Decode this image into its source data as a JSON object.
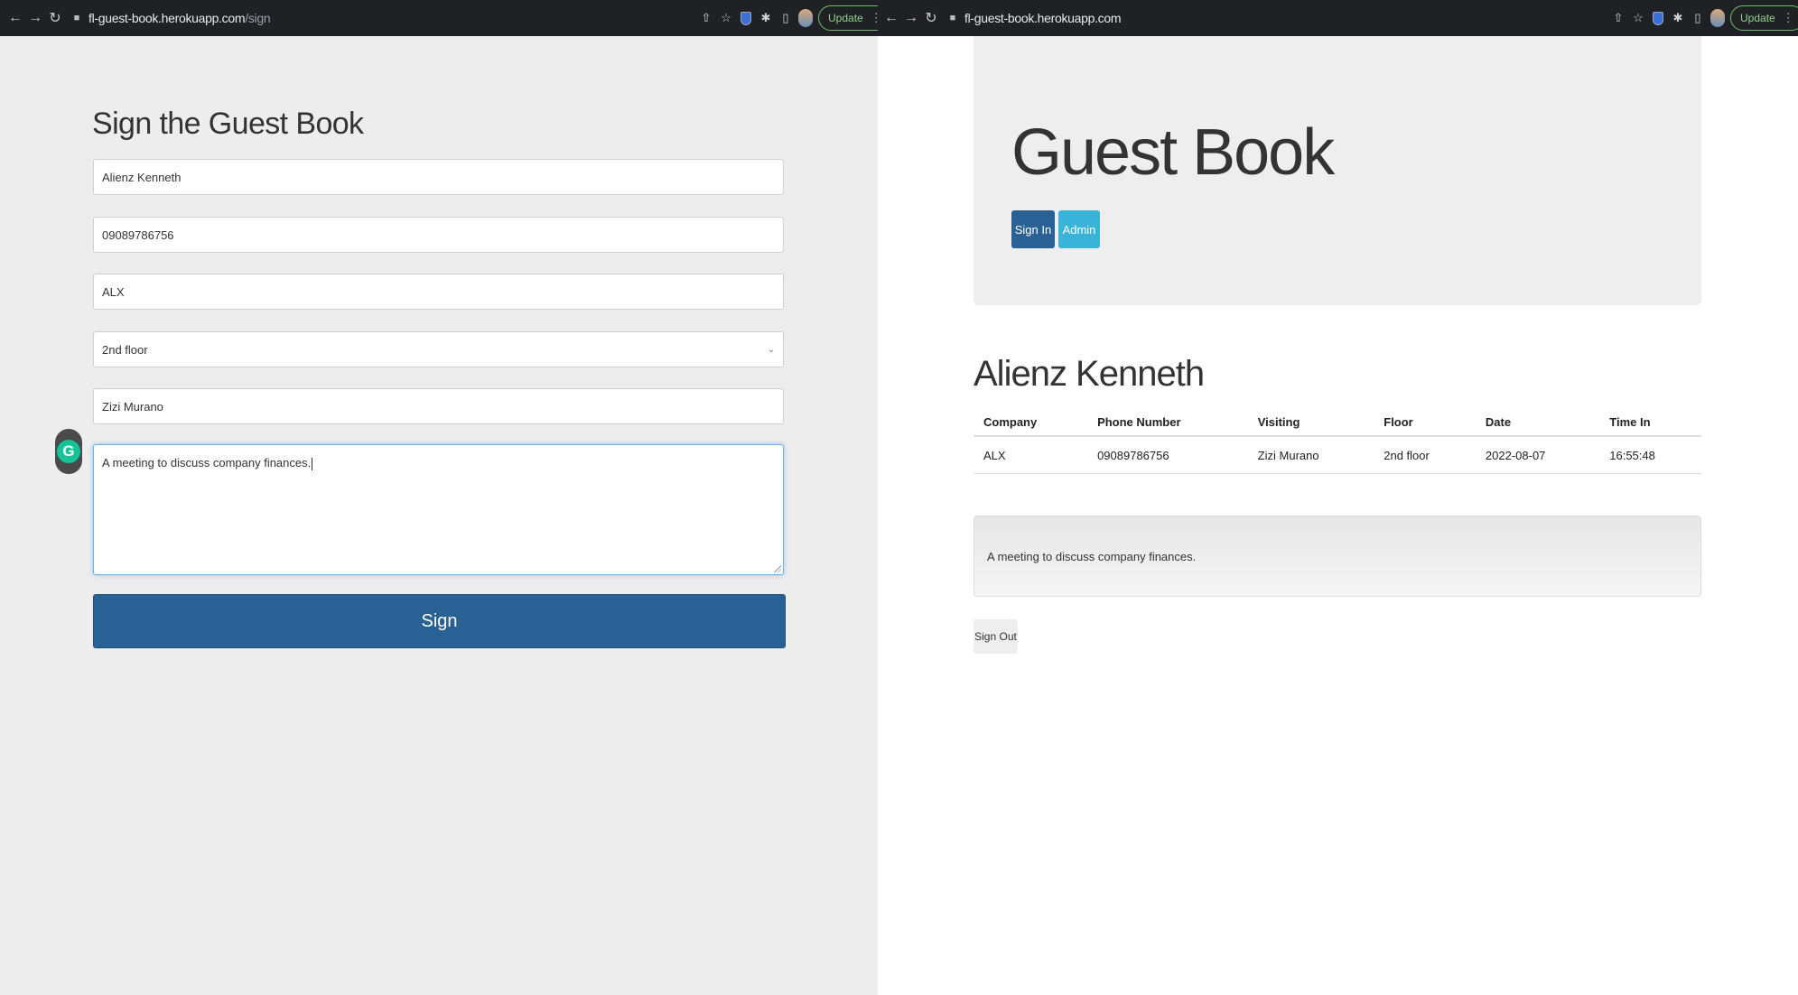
{
  "left_browser": {
    "url_host": "fl-guest-book.herokuapp.com",
    "url_path": "/sign",
    "update_label": "Update"
  },
  "right_browser": {
    "url_host": "fl-guest-book.herokuapp.com",
    "url_path": "",
    "update_label": "Update"
  },
  "sign_form": {
    "title": "Sign the Guest Book",
    "name_value": "Alienz Kenneth",
    "phone_value": "09089786756",
    "company_value": "ALX",
    "floor_selected": "2nd floor",
    "host_value": "Zizi Murano",
    "purpose_value": "A meeting to discuss company finances.",
    "submit_label": "Sign"
  },
  "grammarly": {
    "letter": "G"
  },
  "guest_book": {
    "title": "Guest Book",
    "signin_label": "Sign In",
    "admin_label": "Admin",
    "visitor_name": "Alienz Kenneth",
    "table": {
      "headers": [
        "Company",
        "Phone Number",
        "Visiting",
        "Floor",
        "Date",
        "Time In"
      ],
      "rows": [
        [
          "ALX",
          "09089786756",
          "Zizi Murano",
          "2nd floor",
          "2022-08-07",
          "16:55:48"
        ]
      ]
    },
    "purpose": "A meeting to discuss company finances.",
    "signout_label": "Sign Out"
  }
}
